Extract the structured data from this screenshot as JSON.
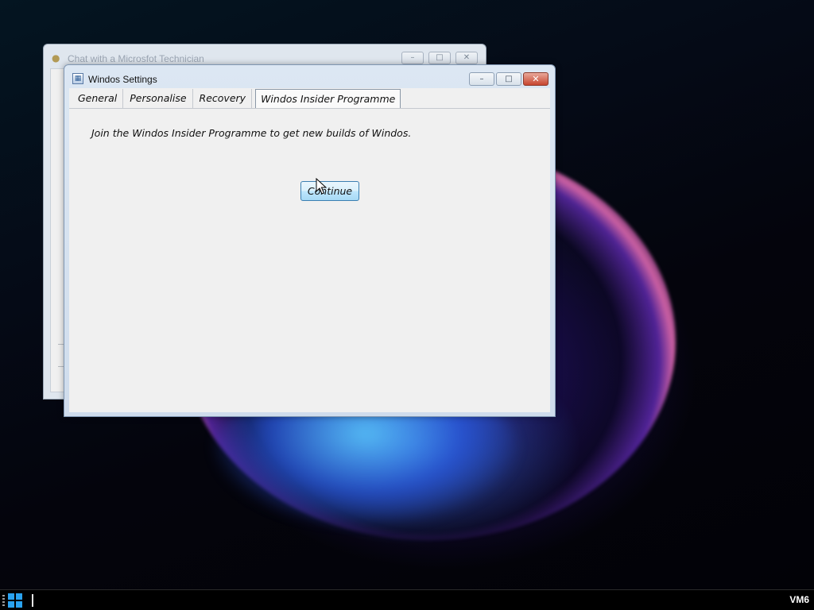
{
  "background_window": {
    "title": "Chat with a Microsfot Technician",
    "icon": "users-icon",
    "controls": [
      "minimize",
      "maximize",
      "close"
    ]
  },
  "settings_window": {
    "title": "Windos Settings",
    "icon": "settings-window-icon",
    "tabs": [
      {
        "label": "General",
        "active": false
      },
      {
        "label": "Personalise",
        "active": false
      },
      {
        "label": "Recovery",
        "active": false
      },
      {
        "label": "Windos Insider Programme",
        "active": true
      }
    ],
    "panel": {
      "text": "Join the Windos Insider Programme to get new builds of Windos.",
      "continue_label": "Continue"
    }
  },
  "taskbar": {
    "start_icon": "windows-logo-icon",
    "vm_label": "VM6"
  },
  "colors": {
    "close_button": "#c7452f",
    "accent_button_border": "#3c7fb1",
    "start_logo": "#2aa3f0"
  }
}
